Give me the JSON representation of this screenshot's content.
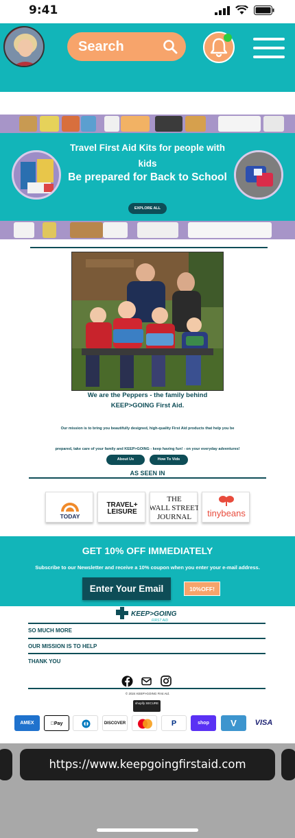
{
  "status": {
    "time": "9:41"
  },
  "header": {
    "search_label": "Search"
  },
  "hero": {
    "line1": "Travel First Aid Kits for people with kids",
    "line2": "Be prepared for Back to School",
    "cta": "EXPLORE ALL"
  },
  "about": {
    "intro": "We are the Peppers - the family behind KEEP>GOING First Aid.",
    "mission_1": "Our mission is to bring you beautifully designed, high-quality First Aid products that help you be",
    "mission_2": "prepared, take care of your family and KEEP>GOING - keep having fun! - on your everyday adventures!",
    "about_btn": "About Us",
    "video_btn": "How To Vids",
    "as_seen_in": "AS SEEN IN"
  },
  "press": [
    {
      "name": "TODAY"
    },
    {
      "name": "TRAVEL+ LEISURE"
    },
    {
      "name": "THE WALL STREET JOURNAL"
    },
    {
      "name": "tinybeans"
    }
  ],
  "newsletter": {
    "title": "GET 10% OFF IMMEDIATELY",
    "subtitle": "Subscribe to our Newsletter and receive a 10% coupon when you enter your e-mail address.",
    "email_btn": "Enter Your Email",
    "coupon_btn": "10%OFF!"
  },
  "footer": {
    "logo_text": "KEEP>GOING",
    "logo_sub": "FIRST AID",
    "links": [
      "SO MUCH MORE",
      "OUR MISSION IS TO HELP",
      "THANK YOU"
    ],
    "copyright": "© 2024 KEEP>GOING First Aid.",
    "shopify": "shopify SECURE",
    "payments": [
      "AMEX",
      "Apple Pay",
      "Diners",
      "DISCOVER",
      "Mastercard",
      "PayPal",
      "shop",
      "Venmo",
      "VISA"
    ]
  },
  "browser": {
    "url": "https://www.keepgoingfirstaid.com"
  },
  "colors": {
    "teal": "#12b5b9",
    "dark_teal": "#0e4d57",
    "orange": "#f7a46b"
  }
}
